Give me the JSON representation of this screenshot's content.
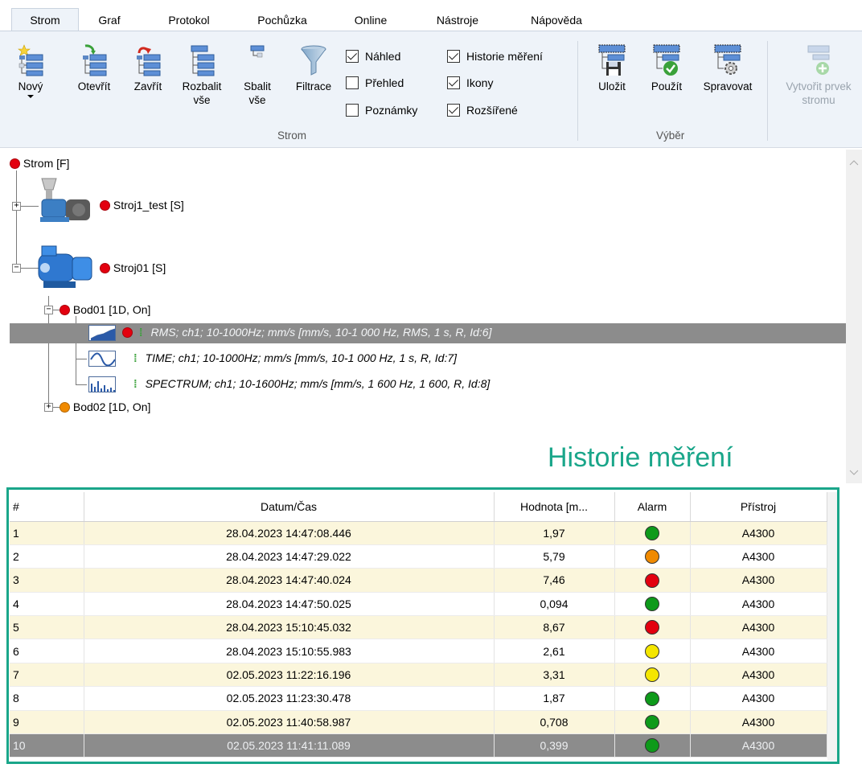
{
  "tabs": [
    "Strom",
    "Graf",
    "Protokol",
    "Pochůzka",
    "Online",
    "Nástroje",
    "Nápověda"
  ],
  "ribbon": {
    "novy": "Nový",
    "otevrit": "Otevřít",
    "zavrit": "Zavřít",
    "rozbalit": "Rozbalit vše",
    "sbalit": "Sbalit vše",
    "filtrace": "Filtrace",
    "checks": {
      "nahled": "Náhled",
      "prehled": "Přehled",
      "poznamky": "Poznámky",
      "historie": "Historie měření",
      "ikony": "Ikony",
      "rozsirene": "Rozšířené"
    },
    "check_state": {
      "nahled": true,
      "prehled": false,
      "poznamky": false,
      "historie": true,
      "ikony": true,
      "rozsirene": true
    },
    "group_strom": "Strom",
    "ulozit": "Uložit",
    "pouzit": "Použít",
    "spravovat": "Spravovat",
    "group_vyber": "Výběr",
    "vytvorit": "Vytvořit prvek stromu"
  },
  "tree": {
    "root": "Strom [F]",
    "stroj1": "Stroj1_test [S]",
    "stroj01": "Stroj01 [S]",
    "bod01": "Bod01 [1D, On]",
    "rms": "RMS; ch1; 10-1000Hz; mm/s [mm/s, 10-1 000 Hz, RMS, 1 s, R, Id:6]",
    "time": "TIME; ch1; 10-1000Hz; mm/s [mm/s, 10-1 000 Hz, 1 s, R, Id:7]",
    "spectrum": "SPECTRUM; ch1; 10-1600Hz; mm/s [mm/s, 1 600 Hz, 1 600, R, Id:8]",
    "bod02": "Bod02 [1D, On]"
  },
  "history_title": "Historie měření",
  "table": {
    "headers": [
      "#",
      "Datum/Čas",
      "Hodnota [m...",
      "Alarm",
      "Přístroj"
    ],
    "rows": [
      {
        "n": "1",
        "dt": "28.04.2023 14:47:08.446",
        "val": "1,97",
        "alarm": "green",
        "dev": "A4300"
      },
      {
        "n": "2",
        "dt": "28.04.2023 14:47:29.022",
        "val": "5,79",
        "alarm": "orange",
        "dev": "A4300"
      },
      {
        "n": "3",
        "dt": "28.04.2023 14:47:40.024",
        "val": "7,46",
        "alarm": "red",
        "dev": "A4300"
      },
      {
        "n": "4",
        "dt": "28.04.2023 14:47:50.025",
        "val": "0,094",
        "alarm": "green",
        "dev": "A4300"
      },
      {
        "n": "5",
        "dt": "28.04.2023 15:10:45.032",
        "val": "8,67",
        "alarm": "red",
        "dev": "A4300"
      },
      {
        "n": "6",
        "dt": "28.04.2023 15:10:55.983",
        "val": "2,61",
        "alarm": "yellow",
        "dev": "A4300"
      },
      {
        "n": "7",
        "dt": "02.05.2023 11:22:16.196",
        "val": "3,31",
        "alarm": "yellow",
        "dev": "A4300"
      },
      {
        "n": "8",
        "dt": "02.05.2023 11:23:30.478",
        "val": "1,87",
        "alarm": "green",
        "dev": "A4300"
      },
      {
        "n": "9",
        "dt": "02.05.2023 11:40:58.987",
        "val": "0,708",
        "alarm": "green",
        "dev": "A4300"
      },
      {
        "n": "10",
        "dt": "02.05.2023 11:41:11.089",
        "val": "0,399",
        "alarm": "green",
        "dev": "A4300"
      }
    ]
  },
  "colors": {
    "green": "#0e9a1a",
    "orange": "#f08a00",
    "red": "#e3000f",
    "yellow": "#f4e600",
    "accent": "#1aa68a"
  }
}
